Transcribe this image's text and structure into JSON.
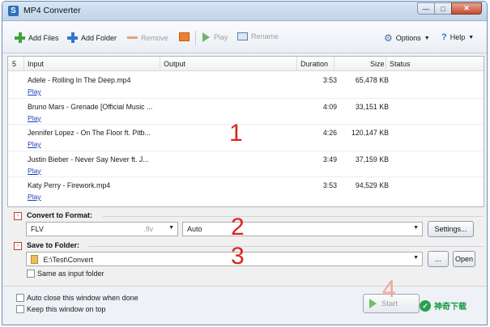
{
  "window": {
    "title": "MP4 Converter"
  },
  "toolbar": {
    "add_files": "Add Files",
    "add_folder": "Add Folder",
    "remove": "Remove",
    "play": "Play",
    "rename": "Rename",
    "options": "Options",
    "help": "Help"
  },
  "file_list": {
    "count": "5",
    "columns": {
      "input": "Input",
      "output": "Output",
      "duration": "Duration",
      "size": "Size",
      "status": "Status"
    },
    "play_label": "Play",
    "rows": [
      {
        "name": "Adele - Rolling In The Deep.mp4",
        "duration": "3:53",
        "size": "65,478 KB"
      },
      {
        "name": "Bruno Mars - Grenade [Official Music ...",
        "duration": "4:09",
        "size": "33,151 KB"
      },
      {
        "name": "Jennifer Lopez - On The Floor ft. Pitb...",
        "duration": "4:26",
        "size": "120,147 KB"
      },
      {
        "name": "Justin Bieber - Never Say Never ft. J...",
        "duration": "3:49",
        "size": "37,159 KB"
      },
      {
        "name": "Katy Perry - Firework.mp4",
        "duration": "3:53",
        "size": "94,529 KB"
      }
    ]
  },
  "convert": {
    "label": "Convert to Format:",
    "format": "FLV",
    "format_ext": ".flv",
    "quality": "Auto",
    "settings_button": "Settings..."
  },
  "save": {
    "label": "Save to Folder:",
    "path": "E:\\Test\\Convert",
    "browse_button": "...",
    "open_button": "Open",
    "same_as_input": "Same as input folder"
  },
  "options": {
    "auto_close": "Auto close this window when done",
    "keep_on_top": "Keep this window on top"
  },
  "start_button": "Start",
  "annotations": [
    "1",
    "2",
    "3",
    "4"
  ],
  "watermark": "神奇下载"
}
